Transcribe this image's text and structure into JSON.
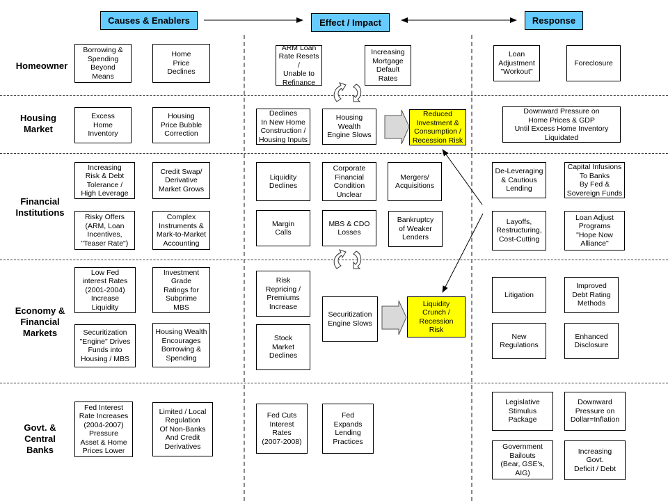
{
  "headers": {
    "causes": "Causes & Enablers",
    "effect": "Effect / Impact",
    "response": "Response"
  },
  "rows": [
    {
      "label": "Homeowner"
    },
    {
      "label": "Housing\nMarket"
    },
    {
      "label": "Financial\nInstitutions"
    },
    {
      "label": "Economy &\nFinancial\nMarkets"
    },
    {
      "label": "Govt. &\nCentral\nBanks"
    }
  ],
  "causes": {
    "homeowner": [
      "Borrowing &\nSpending\nBeyond\nMeans",
      "Home\nPrice\nDeclines"
    ],
    "housing": [
      "Excess\nHome\nInventory",
      "Housing\nPrice Bubble\nCorrection"
    ],
    "financial": [
      "Increasing\nRisk & Debt\nTolerance /\nHigh Leverage",
      "Credit Swap/\nDerivative\nMarket Grows",
      "Risky Offers\n(ARM, Loan\nIncentives,\n\"Teaser Rate\")",
      "Complex\nInstruments &\nMark-to-Market\nAccounting"
    ],
    "economy": [
      "Low Fed\ninterest Rates\n(2001-2004)\nIncrease\nLiquidity",
      "Investment\nGrade\nRatings for\nSubprime\nMBS",
      "Securitization\n\"Engine\" Drives\nFunds into\nHousing / MBS",
      "Housing Wealth\nEncourages\nBorrowing &\nSpending"
    ],
    "govt": [
      "Fed Interest\nRate Increases\n(2004-2007)\nPressure\nAsset & Home\nPrices Lower",
      "Limited / Local\nRegulation\nOf Non-Banks\nAnd Credit\nDerivatives"
    ]
  },
  "effects": {
    "homeowner": [
      "ARM Loan\nRate Resets /\nUnable to\nRefinance",
      "Increasing\nMortgage\nDefault\nRates"
    ],
    "housing": [
      "Declines\nIn New Home\nConstruction /\nHousing Inputs",
      "Housing\nWealth\nEngine Slows"
    ],
    "housing_outcome": "Reduced\nInvestment &\nConsumption /\nRecession Risk",
    "financial": [
      "Liquidity\nDeclines",
      "Corporate\nFinancial\nCondition\nUnclear",
      "Mergers/\nAcquisitions",
      "Margin\nCalls",
      "MBS & CDO\nLosses",
      "Bankruptcy\nof Weaker\nLenders"
    ],
    "economy": [
      "Risk\nRepricing /\nPremiums\nIncrease",
      "Stock\nMarket\nDeclines",
      "Securitization\nEngine Slows"
    ],
    "economy_outcome": "Liquidity\nCrunch /\nRecession\nRisk",
    "govt": [
      "Fed Cuts\nInterest\nRates\n(2007-2008)",
      "Fed\nExpands\nLending\nPractices"
    ]
  },
  "responses": {
    "homeowner": [
      "Loan\nAdjustment\n\"Workout\"",
      "Foreclosure"
    ],
    "housing": [
      "Downward Pressure on\nHome Prices & GDP\nUntil Excess Home Inventory\nLiquidated"
    ],
    "financial": [
      "De-Leveraging\n& Cautious\nLending",
      "Capital Infusions\nTo Banks\nBy Fed &\nSovereign Funds",
      "Layoffs,\nRestructuring,\nCost-Cutting",
      "Loan Adjust\nPrograms\n\"Hope Now\nAlliance\""
    ],
    "economy": [
      "Litigation",
      "Improved\nDebt Rating\nMethods",
      "New\nRegulations",
      "Enhanced\nDisclosure"
    ],
    "govt": [
      "Legislative\nStimulus\nPackage",
      "Downward\nPressure on\nDollar=Inflation",
      "Government\nBailouts\n(Bear, GSE's,\nAIG)",
      "Increasing\nGovt.\nDeficit / Debt"
    ]
  },
  "colors": {
    "header_fill": "#66ccff",
    "highlight_fill": "#ffff00",
    "block_arrow_fill": "#d9d9d9"
  }
}
